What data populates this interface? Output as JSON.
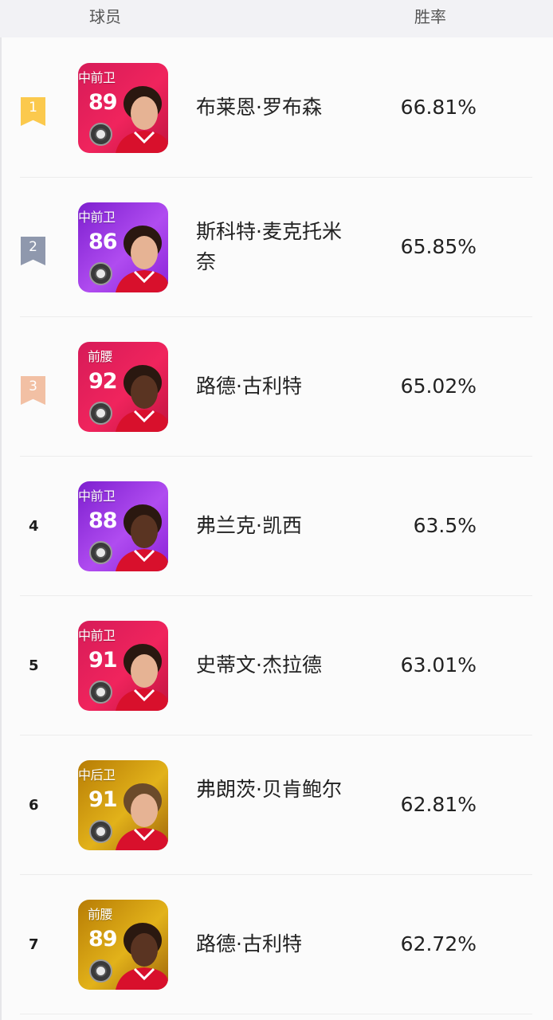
{
  "header": {
    "player_label": "球员",
    "winrate_label": "胜率"
  },
  "rows": [
    {
      "rank": "1",
      "rank_style": "gold",
      "position": "中前卫",
      "rating": "89",
      "name": "布莱恩·罗布森",
      "winrate": "66.81%",
      "card_color": "red"
    },
    {
      "rank": "2",
      "rank_style": "silver",
      "position": "中前卫",
      "rating": "86",
      "name": "斯科特·麦克托米奈",
      "winrate": "65.85%",
      "card_color": "purple"
    },
    {
      "rank": "3",
      "rank_style": "bronze",
      "position": "前腰",
      "rating": "92",
      "name": "路德·古利特",
      "winrate": "65.02%",
      "card_color": "red"
    },
    {
      "rank": "4",
      "rank_style": "plain",
      "position": "中前卫",
      "rating": "88",
      "name": "弗兰克·凯西",
      "winrate": "63.5%",
      "card_color": "purple"
    },
    {
      "rank": "5",
      "rank_style": "plain",
      "position": "中前卫",
      "rating": "91",
      "name": "史蒂文·杰拉德",
      "winrate": "63.01%",
      "card_color": "red"
    },
    {
      "rank": "6",
      "rank_style": "plain",
      "position": "中后卫",
      "rating": "91",
      "name": "弗朗茨·贝肯鲍尔",
      "winrate": "62.81%",
      "card_color": "gold"
    },
    {
      "rank": "7",
      "rank_style": "plain",
      "position": "前腰",
      "rating": "89",
      "name": "路德·古利特",
      "winrate": "62.72%",
      "card_color": "gold"
    }
  ],
  "colors": {
    "gold_ribbon": "#fbc94d",
    "silver_ribbon": "#8f98ad",
    "bronze_ribbon": "#f2c0a4",
    "card_red": "#e8195a",
    "card_purple": "#9b2fe0",
    "card_gold": "#d8a10a"
  }
}
